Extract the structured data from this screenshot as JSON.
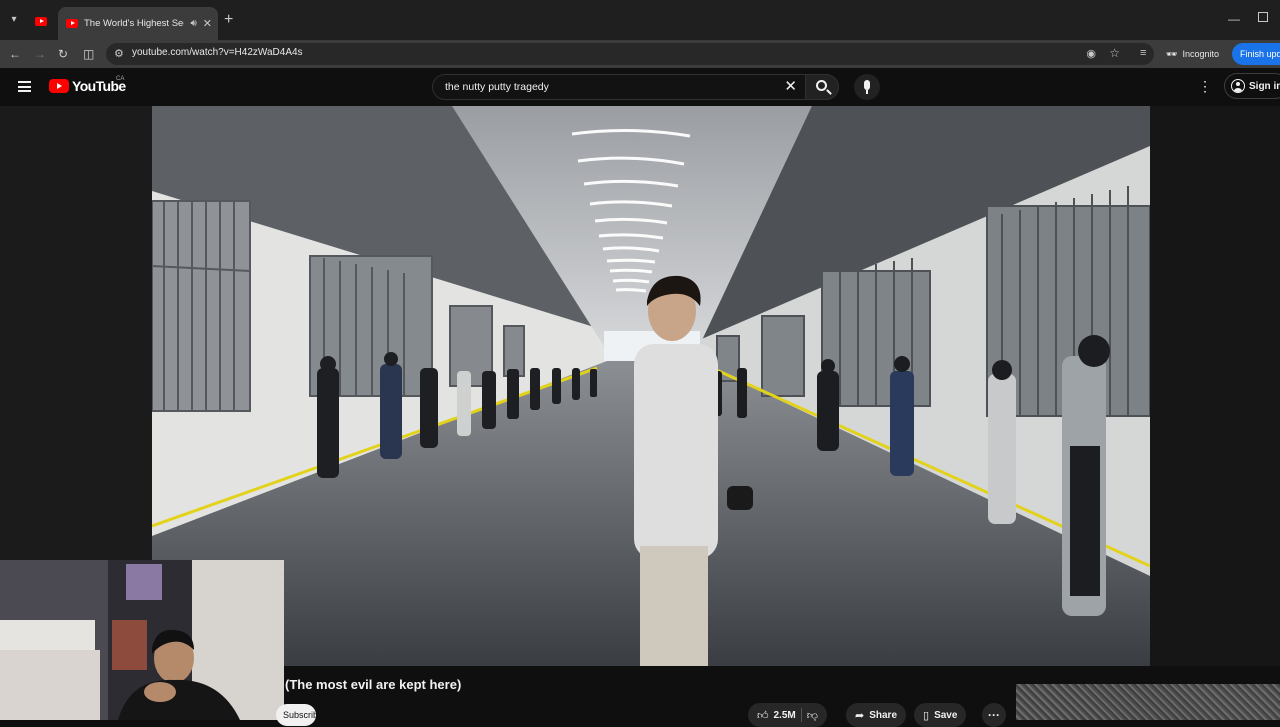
{
  "browser": {
    "pinned_tab_icon": "youtube-favicon",
    "active_tab_title": "The World's Highest Security",
    "url": "youtube.com/watch?v=H42zWaD4A4s",
    "incognito_label": "Incognito",
    "finish_update_label": "Finish update"
  },
  "masthead": {
    "logo_text": "YouTube",
    "country_code": "CA",
    "search_query": "the nutty putty tragedy",
    "sign_in_label": "Sign in"
  },
  "video": {
    "title_visible": "(The most evil are kept here)",
    "subscribe_label": "Subscribe",
    "like_count": "2.5M",
    "share_label": "Share",
    "save_label": "Save"
  },
  "colors": {
    "page_bg": "#0f0f0f",
    "youtube_red": "#ff0000",
    "accent_blue": "#1a73e8",
    "floor_stripe": "#e3d21a"
  }
}
